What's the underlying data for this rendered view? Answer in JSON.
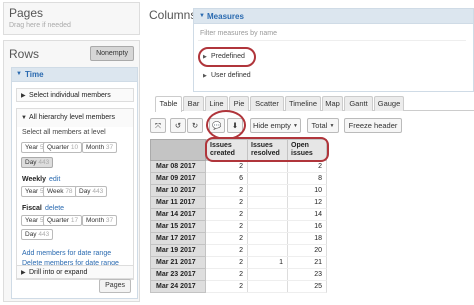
{
  "pages": {
    "title": "Pages",
    "hint": "Drag here if needed"
  },
  "rows": {
    "title": "Rows",
    "nonempty_label": "Nonempty",
    "dimension": "Time",
    "select_individual": "Select individual members",
    "all_hierarchy": "All hierarchy level members",
    "select_all_at_level": "Select all members at level",
    "default_levels": [
      {
        "name": "Year",
        "count": "5"
      },
      {
        "name": "Quarter",
        "count": "10"
      },
      {
        "name": "Month",
        "count": "37"
      },
      {
        "name": "Day",
        "count": "443"
      }
    ],
    "weekly_label": "Weekly",
    "weekly_edit": "edit",
    "weekly_levels": [
      {
        "name": "Year",
        "count": "5"
      },
      {
        "name": "Week",
        "count": "78"
      },
      {
        "name": "Day",
        "count": "443"
      }
    ],
    "fiscal_label": "Fiscal",
    "fiscal_delete": "delete",
    "fiscal_levels": [
      {
        "name": "Year",
        "count": "5"
      },
      {
        "name": "Quarter",
        "count": "17"
      },
      {
        "name": "Month",
        "count": "37"
      },
      {
        "name": "Day",
        "count": "443"
      }
    ],
    "add_members_link": "Add members for date range",
    "delete_members_link": "Delete members for date range",
    "drill_label": "Drill into or expand",
    "pages_button": "Pages"
  },
  "columns": {
    "title": "Columns",
    "measures_label": "Measures",
    "filter_placeholder": "Filter measures by name",
    "predefined_label": "Predefined",
    "user_defined_label": "User defined"
  },
  "tabs": [
    "Table",
    "Bar",
    "Line",
    "Pie",
    "Scatter",
    "Timeline",
    "Map",
    "Gantt",
    "Gauge"
  ],
  "toolbar": {
    "hide_empty": "Hide empty",
    "total": "Total",
    "freeze_header": "Freeze header"
  },
  "table": {
    "headers": [
      "Issues created",
      "Issues resolved",
      "Open issues"
    ],
    "rows": [
      {
        "date": "Mar 08 2017",
        "created": "2",
        "resolved": "",
        "open": "2"
      },
      {
        "date": "Mar 09 2017",
        "created": "6",
        "resolved": "",
        "open": "8"
      },
      {
        "date": "Mar 10 2017",
        "created": "2",
        "resolved": "",
        "open": "10"
      },
      {
        "date": "Mar 11 2017",
        "created": "2",
        "resolved": "",
        "open": "12"
      },
      {
        "date": "Mar 14 2017",
        "created": "2",
        "resolved": "",
        "open": "14"
      },
      {
        "date": "Mar 15 2017",
        "created": "2",
        "resolved": "",
        "open": "16"
      },
      {
        "date": "Mar 17 2017",
        "created": "2",
        "resolved": "",
        "open": "18"
      },
      {
        "date": "Mar 19 2017",
        "created": "2",
        "resolved": "",
        "open": "20"
      },
      {
        "date": "Mar 21 2017",
        "created": "2",
        "resolved": "1",
        "open": "21"
      },
      {
        "date": "Mar 23 2017",
        "created": "2",
        "resolved": "",
        "open": "23"
      },
      {
        "date": "Mar 24 2017",
        "created": "2",
        "resolved": "",
        "open": "25"
      }
    ]
  },
  "colors": {
    "highlight_ring": "#b0353b",
    "accent": "#2a6ab0"
  }
}
